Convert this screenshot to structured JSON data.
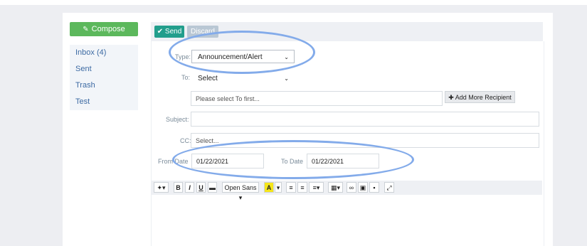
{
  "sidebar": {
    "compose_label": "Compose",
    "items": [
      {
        "label": "Inbox (4)"
      },
      {
        "label": "Sent"
      },
      {
        "label": "Trash"
      },
      {
        "label": "Test"
      }
    ]
  },
  "toolbar": {
    "send_label": "Send",
    "discard_label": "Discard"
  },
  "form": {
    "type_label": "Type:",
    "type_value": "Announcement/Alert",
    "to_label": "To:",
    "to_value": "Select",
    "recipient_placeholder": "Please select To first...",
    "add_recipient_label": "Add More Recipient",
    "subject_label": "Subject:",
    "subject_value": "",
    "cc_label": "CC:",
    "cc_placeholder": "Select...",
    "from_date_label": "From Date",
    "from_date_value": "01/22/2021",
    "to_date_label": "To Date",
    "to_date_value": "01/22/2021"
  },
  "editor": {
    "font_name": "Open Sans"
  },
  "colors": {
    "compose_green": "#5cb85c",
    "send_teal": "#229e8c",
    "discard_gray": "#b9c7d4",
    "annotation_blue": "#83abea",
    "link_blue": "#3c6aa3"
  }
}
